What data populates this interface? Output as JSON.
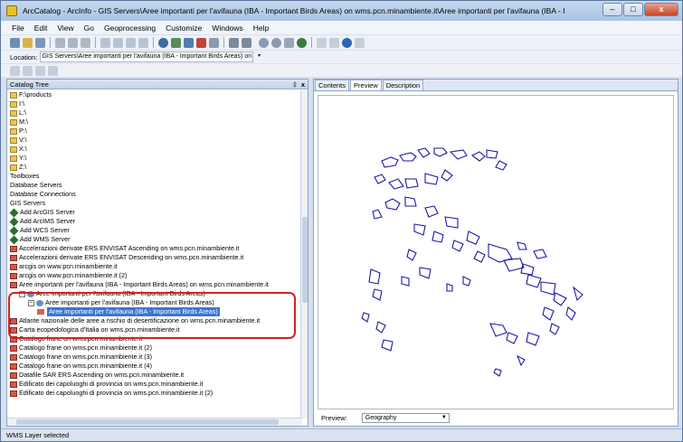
{
  "window": {
    "title": "ArcCatalog - ArcInfo - GIS Servers\\Aree importanti per l'avifauna (IBA - Important Birds Areas) on wms.pcn.minambiente.it\\Aree importanti per l'avifauna (IBA - Important Birds Areas)\\Aree importa...",
    "minimize_label": "–",
    "maximize_label": "□",
    "close_label": "x"
  },
  "menu": [
    "File",
    "Edit",
    "View",
    "Go",
    "Geoprocessing",
    "Customize",
    "Windows",
    "Help"
  ],
  "location": {
    "label": "Location:",
    "value": "GIS Servers\\Aree importanti per l'avifauna (IBA - Important Birds Areas) on wms.pcn.minambi"
  },
  "catalog": {
    "title": "Catalog Tree",
    "pin": "‡",
    "close": "x",
    "rows": [
      {
        "text": "F:\\products",
        "icon": "folder",
        "indent": 0
      },
      {
        "text": "I:\\",
        "icon": "folder",
        "indent": 0
      },
      {
        "text": "L:\\",
        "icon": "folder",
        "indent": 0
      },
      {
        "text": "M:\\",
        "icon": "folder",
        "indent": 0
      },
      {
        "text": "P:\\",
        "icon": "folder",
        "indent": 0
      },
      {
        "text": "V:\\",
        "icon": "folder",
        "indent": 0
      },
      {
        "text": "X:\\",
        "icon": "folder",
        "indent": 0
      },
      {
        "text": "Y:\\",
        "icon": "folder",
        "indent": 0
      },
      {
        "text": "Z:\\",
        "icon": "folder",
        "indent": 0
      },
      {
        "text": "Toolboxes",
        "icon": "none",
        "indent": 0
      },
      {
        "text": "Database Servers",
        "icon": "none",
        "indent": 0
      },
      {
        "text": "Database Connections",
        "icon": "none",
        "indent": 0
      },
      {
        "text": "GIS Servers",
        "icon": "none",
        "indent": 0
      },
      {
        "text": "Add ArcGIS Server",
        "icon": "diamond",
        "indent": 0
      },
      {
        "text": "Add ArcIMS Server",
        "icon": "diamond",
        "indent": 0
      },
      {
        "text": "Add WCS Server",
        "icon": "diamond",
        "indent": 0
      },
      {
        "text": "Add WMS Server",
        "icon": "diamond",
        "indent": 0
      },
      {
        "text": "Accelerazioni derivate ERS ENVISAT Ascending on wms.pcn.minambiente.it",
        "icon": "server",
        "indent": 0
      },
      {
        "text": "Accelerazioni derivate ERS ENVISAT Descending on wms.pcn.minambiente.it",
        "icon": "server",
        "indent": 0
      },
      {
        "text": "arcgis on www.pcn.minambiente.it",
        "icon": "server",
        "indent": 0
      },
      {
        "text": "arcgis on www.pcn.minambiente.it (2)",
        "icon": "server",
        "indent": 0
      },
      {
        "text": "Aree importanti per l'avifauna (IBA - Important Birds Areas) on wms.pcn.minambiente.it",
        "icon": "server",
        "indent": 0
      },
      {
        "text": "Aree importanti per l'avifauna (IBA - Important Birds Areas)",
        "icon": "globe",
        "indent": 1,
        "expander": "-"
      },
      {
        "text": "Aree importanti per l'avifauna (IBA - Important Birds Areas)",
        "icon": "globe",
        "indent": 2,
        "expander": "-"
      },
      {
        "text": "Aree importanti per l'avifauna (IBA - Important Birds Areas)",
        "icon": "layer",
        "indent": 3,
        "selected": true
      },
      {
        "text": "Atlante nazionale delle aree a rischio di desertificazione on wms.pcn.minambiente.it",
        "icon": "server",
        "indent": 0
      },
      {
        "text": "Carta ecopedologica d'Italia on wms.pcn.minambiente.it",
        "icon": "server",
        "indent": 0
      },
      {
        "text": "Catalogo frane on wms.pcn.minambiente.it",
        "icon": "server",
        "indent": 0
      },
      {
        "text": "Catalogo frane on wms.pcn.minambiente.it (2)",
        "icon": "server",
        "indent": 0
      },
      {
        "text": "Catalogo frane on wms.pcn.minambiente.it (3)",
        "icon": "server",
        "indent": 0
      },
      {
        "text": "Catalogo frane on wms.pcn.minambiente.it (4)",
        "icon": "server",
        "indent": 0
      },
      {
        "text": "Datafile SAR ERS Ascending on wms.pcn.minambiente.it",
        "icon": "server",
        "indent": 0
      },
      {
        "text": "Edificato dei capoluoghi di provincia on wms.pcn.minambiente.it",
        "icon": "server",
        "indent": 0
      },
      {
        "text": "Edificato dei capoluoghi di provincia on wms.pcn.minambiente.it (2)",
        "icon": "server",
        "indent": 0
      }
    ]
  },
  "tabs": [
    "Contents",
    "Preview",
    "Description"
  ],
  "active_tab": "Preview",
  "preview": {
    "label": "Preview:",
    "mode": "Geography"
  },
  "status": "WMS Layer selected",
  "colors": {
    "map_outline": "#1a1aa8",
    "selection": "#3b75d1",
    "highlight": "#d32222"
  }
}
